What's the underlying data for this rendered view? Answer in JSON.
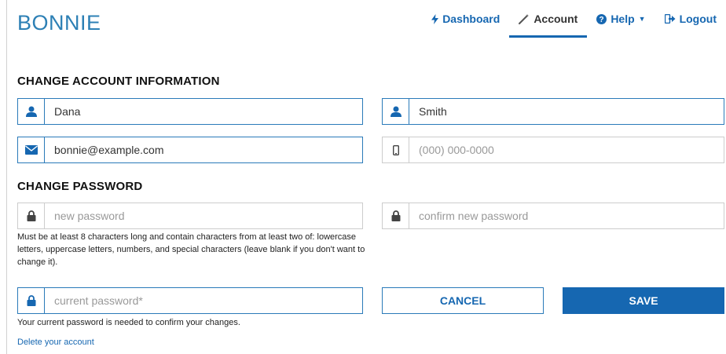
{
  "brand": {
    "logo": "BONNIE"
  },
  "nav": {
    "dashboard": "Dashboard",
    "account": "Account",
    "help": "Help",
    "logout": "Logout"
  },
  "account_section": {
    "title": "CHANGE ACCOUNT INFORMATION",
    "first_name": {
      "value": "Dana"
    },
    "last_name": {
      "value": "Smith"
    },
    "email": {
      "value": "bonnie@example.com"
    },
    "phone": {
      "value": "",
      "placeholder": "(000) 000-0000"
    }
  },
  "password_section": {
    "title": "CHANGE PASSWORD",
    "new_password": {
      "value": "",
      "placeholder": "new password"
    },
    "confirm_password": {
      "value": "",
      "placeholder": "confirm new password"
    },
    "help_text": "Must be at least 8 characters long and contain characters from at least two of: lowercase letters, uppercase letters, numbers, and special characters (leave blank if you don't want to change it).",
    "current_password": {
      "value": "",
      "placeholder": "current password*"
    },
    "current_help": "Your current password is needed to confirm your changes."
  },
  "actions": {
    "cancel": "CANCEL",
    "save": "SAVE"
  },
  "delete_link": "Delete your account",
  "colors": {
    "primary": "#1667b1",
    "logo": "#2d80b5",
    "border": "#cccccc"
  },
  "icons": [
    "bolt-icon",
    "wand-icon",
    "question-circle-icon",
    "sign-out-icon",
    "user-icon",
    "envelope-icon",
    "mobile-icon",
    "lock-icon"
  ]
}
